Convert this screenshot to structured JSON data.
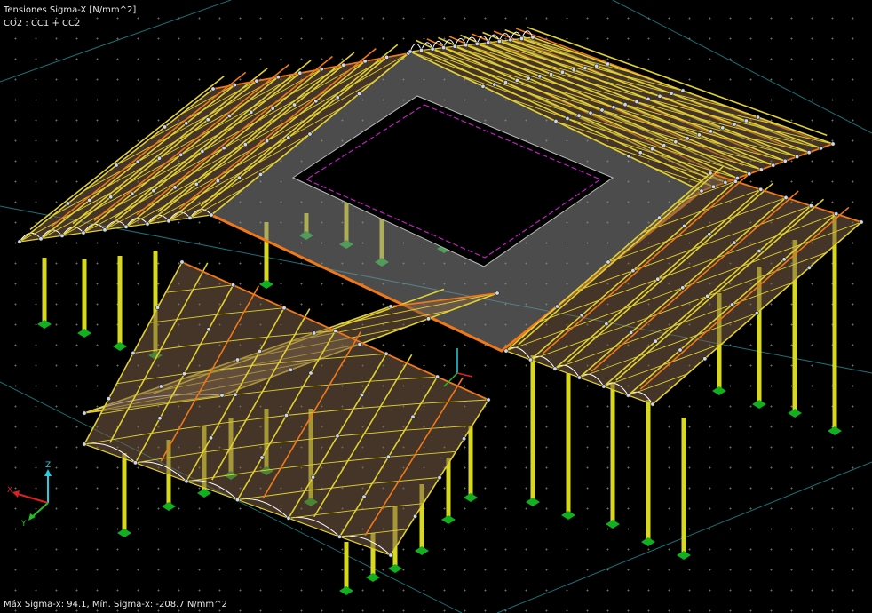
{
  "view": {
    "result_title": "Tensiones Sigma-X [N/mm^2]",
    "load_combination": "CO2 : CC1 + CC2",
    "status_line": "Máx Sigma-x: 94.1, Mín. Sigma-x: -208.7 N/mm^2"
  },
  "axis_triad": {
    "x_label": "X",
    "y_label": "Y",
    "z_label": "Z"
  },
  "colors": {
    "background": "#000000",
    "grid_dot": "#6b6b6b",
    "guide_line": "#1f8f96",
    "column": "#d8d820",
    "support": "#10b020",
    "slab": "#7b6148",
    "slab_edge": "#e8e8e8",
    "opening_outline": "#c020c0",
    "truss": "#e0d030",
    "stress_high": "#f07818",
    "node": "#cfd8e8",
    "axis_x": "#e02020",
    "axis_y": "#20c020",
    "axis_z": "#20d0e0"
  },
  "icons": [
    "axis-triad-icon",
    "local-axis-marker-icon"
  ]
}
